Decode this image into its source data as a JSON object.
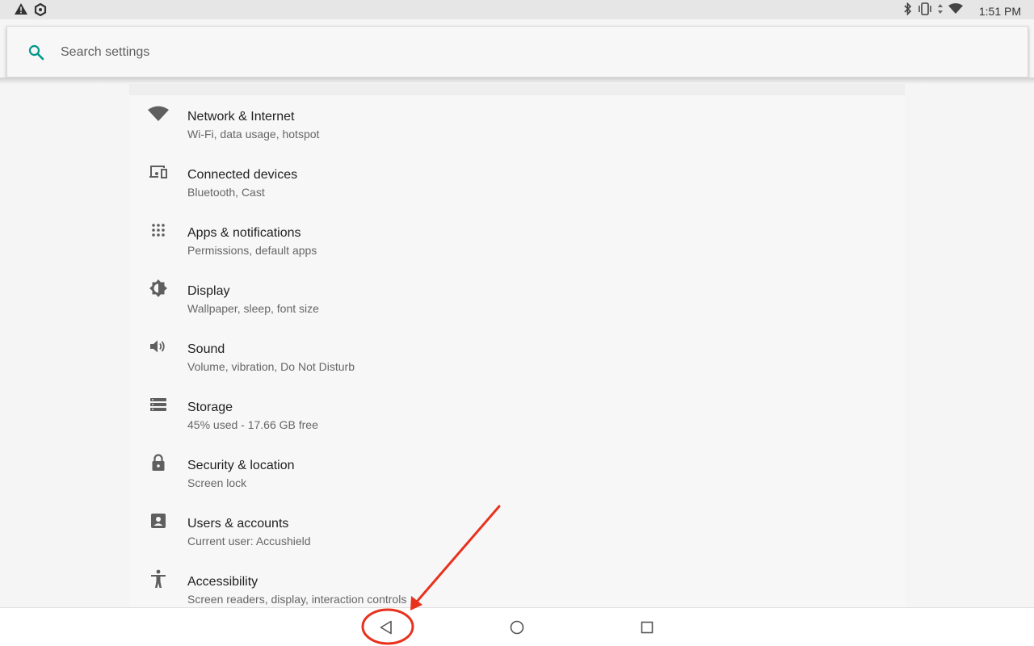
{
  "status_bar": {
    "left_icons": [
      "warning-icon",
      "app-notification-icon"
    ],
    "right_icons": [
      "bluetooth-icon",
      "vibrate-icon",
      "data-arrows-icon",
      "wifi-icon"
    ],
    "time": "1:51 PM"
  },
  "search": {
    "placeholder": "Search settings",
    "value": ""
  },
  "settings": {
    "items": [
      {
        "icon": "wifi-icon",
        "title": "Network & Internet",
        "subtitle": "Wi-Fi, data usage, hotspot"
      },
      {
        "icon": "connected-devices-icon",
        "title": "Connected devices",
        "subtitle": "Bluetooth, Cast"
      },
      {
        "icon": "apps-grid-icon",
        "title": "Apps & notifications",
        "subtitle": "Permissions, default apps"
      },
      {
        "icon": "brightness-icon",
        "title": "Display",
        "subtitle": "Wallpaper, sleep, font size"
      },
      {
        "icon": "volume-icon",
        "title": "Sound",
        "subtitle": "Volume, vibration, Do Not Disturb"
      },
      {
        "icon": "storage-icon",
        "title": "Storage",
        "subtitle": "45% used - 17.66 GB free"
      },
      {
        "icon": "lock-icon",
        "title": "Security & location",
        "subtitle": "Screen lock"
      },
      {
        "icon": "account-icon",
        "title": "Users & accounts",
        "subtitle": "Current user: Accushield"
      },
      {
        "icon": "accessibility-icon",
        "title": "Accessibility",
        "subtitle": "Screen readers, display, interaction controls"
      }
    ]
  },
  "nav_bar": {
    "buttons": [
      "back-icon",
      "home-icon",
      "recents-icon"
    ]
  },
  "annotation": {
    "color": "#e8321e",
    "target": "back-button"
  },
  "colors": {
    "accent": "#009688",
    "icon": "#5f5f5f",
    "background": "#f5f5f5"
  }
}
